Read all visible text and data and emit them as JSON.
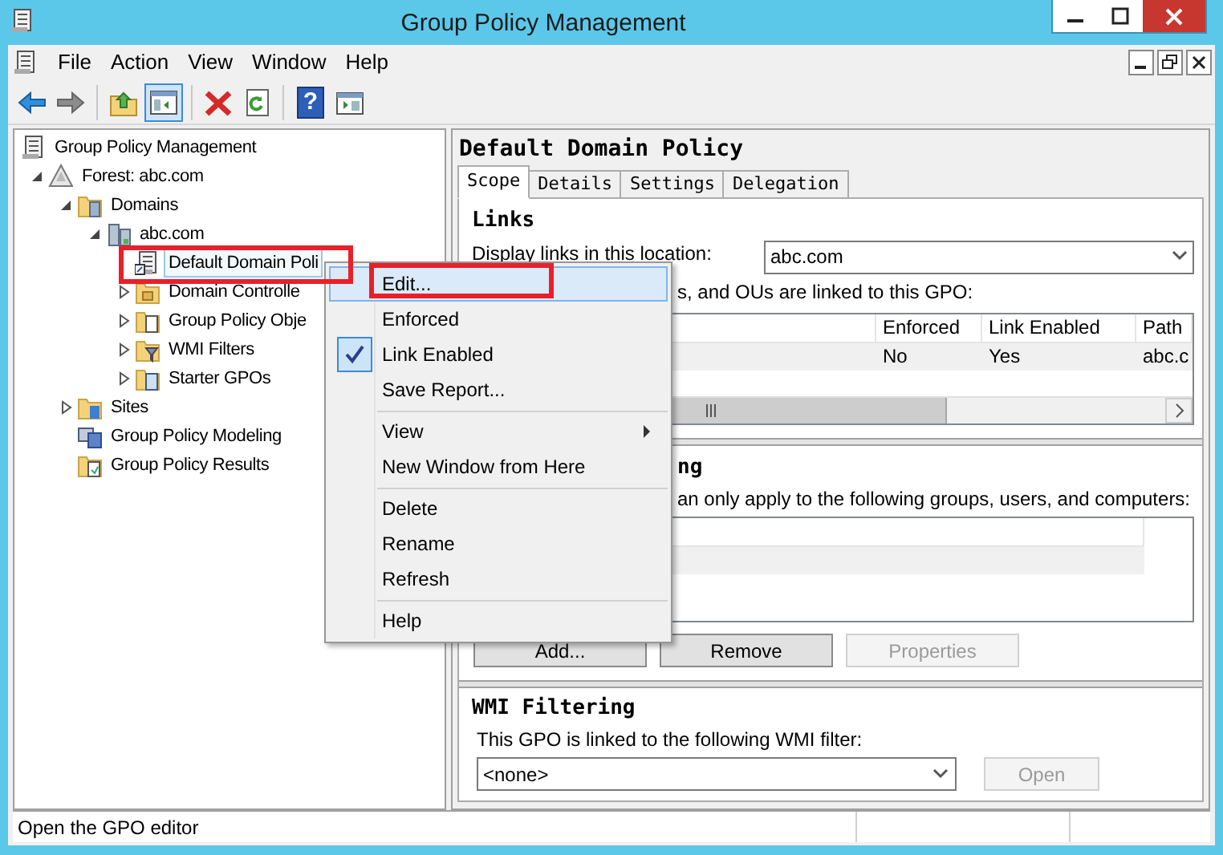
{
  "window": {
    "title": "Group Policy Management"
  },
  "menu_bar": [
    {
      "label": "File"
    },
    {
      "label": "Action"
    },
    {
      "label": "View"
    },
    {
      "label": "Window"
    },
    {
      "label": "Help"
    }
  ],
  "toolbar": [
    {
      "kind": "back",
      "disabled": false
    },
    {
      "kind": "forward",
      "disabled": true
    },
    {
      "kind": "separator"
    },
    {
      "kind": "up"
    },
    {
      "kind": "tree-toggle",
      "selected": true
    },
    {
      "kind": "separator"
    },
    {
      "kind": "delete"
    },
    {
      "kind": "refresh"
    },
    {
      "kind": "separator"
    },
    {
      "kind": "help",
      "glyph": "?"
    },
    {
      "kind": "action-pane"
    }
  ],
  "tree": {
    "label": "Group Policy Management",
    "kind": "console",
    "children": [
      {
        "label": "Forest: abc.com",
        "kind": "forest",
        "expanded": true,
        "children": [
          {
            "label": "Domains",
            "kind": "domains",
            "expanded": true,
            "children": [
              {
                "label": "abc.com",
                "kind": "domain",
                "expanded": true,
                "children": [
                  {
                    "label": "Default Domain Poli",
                    "kind": "gpo-link",
                    "selected": true,
                    "highlighted": true
                  },
                  {
                    "label": "Domain Controlle",
                    "kind": "ou",
                    "expanded": false
                  },
                  {
                    "label": "Group Policy Obje",
                    "kind": "gpo-folder",
                    "expanded": false
                  },
                  {
                    "label": "WMI Filters",
                    "kind": "filter-folder",
                    "expanded": false
                  },
                  {
                    "label": "Starter GPOs",
                    "kind": "starter-folder",
                    "expanded": false
                  }
                ]
              }
            ]
          },
          {
            "label": "Sites",
            "kind": "sites",
            "expanded": false
          },
          {
            "label": "Group Policy Modeling",
            "kind": "modeling"
          },
          {
            "label": "Group Policy Results",
            "kind": "results"
          }
        ]
      }
    ]
  },
  "details": {
    "title": "Default Domain Policy",
    "tabs": [
      {
        "label": "Scope",
        "selected": true
      },
      {
        "label": "Details",
        "selected": false
      },
      {
        "label": "Settings",
        "selected": false
      },
      {
        "label": "Delegation",
        "selected": false
      }
    ],
    "links": {
      "heading": "Links",
      "location_label": "Display links in this location:",
      "location_value": "abc.com",
      "linked_label": "s, and OUs are linked to this GPO:",
      "columns": [
        "Enforced",
        "Link Enabled",
        "Path"
      ],
      "rows": [
        [
          "No",
          "Yes",
          "abc.c"
        ]
      ]
    },
    "security_filtering": {
      "heading": "ng",
      "description": "an only apply to the following groups, users, and computers:",
      "buttons": [
        {
          "label": "Add...",
          "disabled": false
        },
        {
          "label": "Remove",
          "disabled": false
        },
        {
          "label": "Properties",
          "disabled": true
        }
      ]
    },
    "wmi_filtering": {
      "heading": "WMI Filtering",
      "description": "This GPO is linked to the following WMI filter:",
      "value": "<none>",
      "button": {
        "label": "Open",
        "disabled": true
      }
    }
  },
  "context_menu": [
    {
      "kind": "item",
      "label": "Edit...",
      "selected": true,
      "checked": false,
      "submenu": false,
      "highlighted": true
    },
    {
      "kind": "item",
      "label": "Enforced",
      "selected": false,
      "checked": false,
      "submenu": false,
      "highlighted": false
    },
    {
      "kind": "item",
      "label": "Link Enabled",
      "selected": false,
      "checked": true,
      "submenu": false,
      "highlighted": false
    },
    {
      "kind": "item",
      "label": "Save Report...",
      "selected": false,
      "checked": false,
      "submenu": false,
      "highlighted": false
    },
    {
      "kind": "separator"
    },
    {
      "kind": "item",
      "label": "View",
      "selected": false,
      "checked": false,
      "submenu": true,
      "highlighted": false
    },
    {
      "kind": "item",
      "label": "New Window from Here",
      "selected": false,
      "checked": false,
      "submenu": false,
      "highlighted": false
    },
    {
      "kind": "separator"
    },
    {
      "kind": "item",
      "label": "Delete",
      "selected": false,
      "checked": false,
      "submenu": false,
      "highlighted": false
    },
    {
      "kind": "item",
      "label": "Rename",
      "selected": false,
      "checked": false,
      "submenu": false,
      "highlighted": false
    },
    {
      "kind": "item",
      "label": "Refresh",
      "selected": false,
      "checked": false,
      "submenu": false,
      "highlighted": false
    },
    {
      "kind": "separator"
    },
    {
      "kind": "item",
      "label": "Help",
      "selected": false,
      "checked": false,
      "submenu": false,
      "highlighted": false
    }
  ],
  "status_bar": {
    "text": "Open the GPO editor"
  }
}
